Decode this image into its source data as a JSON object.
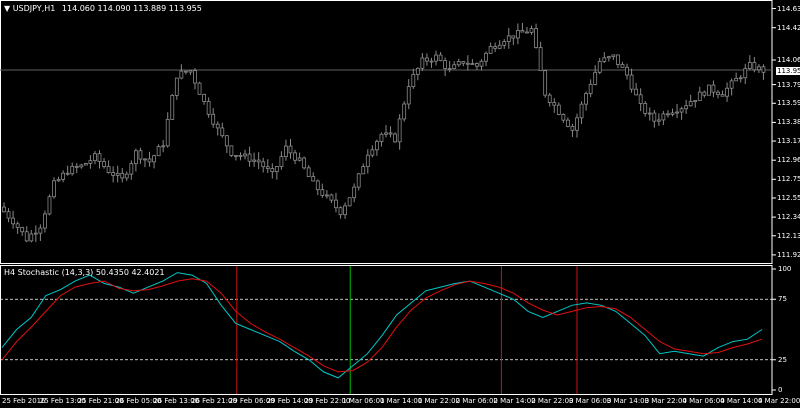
{
  "main_panel": {
    "symbol_label": "USDJPY,H1",
    "ohlc_text": "114.060 114.090 113.889 113.955",
    "current_price": "113.955"
  },
  "indicator_panel": {
    "label": "H4 Stochastic (14,3,3) 50.4350 42.4021"
  },
  "colors": {
    "background": "#000000",
    "grid": "#3a3a3a",
    "candle": "#8a8a8a",
    "main_line": "#00c8c8",
    "signal_line": "#e01010",
    "vline_red": "#d01010",
    "vline_green": "#00c000",
    "level_line": "#ffffff"
  },
  "chart_data": [
    {
      "type": "candlestick",
      "title": "USDJPY,H1",
      "price_axis_ticks": [
        "114.630",
        "114.420",
        "114.065",
        "113.795",
        "113.590",
        "113.380",
        "113.175",
        "112.965",
        "112.755",
        "112.550",
        "112.340",
        "112.135",
        "111.925"
      ],
      "price_range": [
        111.88,
        114.68
      ],
      "time_labels": [
        "25 Feb 2016",
        "25 Feb 13:00",
        "25 Feb 21:00",
        "26 Feb 05:00",
        "26 Feb 13:00",
        "26 Feb 21:00",
        "29 Feb 06:00",
        "29 Feb 14:00",
        "29 Feb 22:00",
        "1 Mar 06:00",
        "1 Mar 14:00",
        "1 Mar 22:00",
        "2 Mar 06:00",
        "2 Mar 14:00",
        "2 Mar 22:00",
        "3 Mar 06:00",
        "3 Mar 14:00",
        "3 Mar 22:00",
        "4 Mar 06:00",
        "4 Mar 14:00",
        "4 Mar 22:00"
      ],
      "close_path": [
        112.45,
        112.3,
        112.1,
        112.25,
        112.7,
        112.85,
        112.9,
        113.0,
        112.85,
        112.75,
        113.05,
        112.95,
        113.15,
        113.9,
        113.95,
        113.6,
        113.3,
        113.05,
        113.0,
        112.95,
        112.8,
        113.1,
        112.95,
        112.7,
        112.55,
        112.4,
        112.65,
        113.05,
        113.25,
        113.2,
        113.8,
        114.05,
        114.1,
        113.95,
        114.05,
        114.0,
        114.2,
        114.3,
        114.35,
        114.4,
        113.7,
        113.5,
        113.3,
        113.7,
        114.05,
        114.1,
        113.9,
        113.55,
        113.4,
        113.5,
        113.55,
        113.65,
        113.75,
        113.7,
        113.85,
        114.0,
        113.95
      ]
    },
    {
      "type": "line",
      "title": "H4 Stochastic (14,3,3)",
      "y_ticks": [
        "100",
        "75",
        "25",
        "0"
      ],
      "ylim": [
        0,
        100
      ],
      "levels": [
        75,
        25
      ],
      "series": [
        {
          "name": "main",
          "values": [
            35,
            50,
            60,
            78,
            83,
            90,
            95,
            88,
            85,
            80,
            85,
            90,
            97,
            95,
            88,
            70,
            55,
            50,
            45,
            40,
            32,
            25,
            15,
            10,
            20,
            30,
            45,
            62,
            72,
            82,
            85,
            88,
            90,
            85,
            80,
            75,
            65,
            60,
            65,
            70,
            72,
            70,
            65,
            55,
            45,
            30,
            32,
            30,
            28,
            35,
            40,
            42,
            50
          ]
        },
        {
          "name": "signal",
          "values": [
            25,
            40,
            52,
            65,
            78,
            85,
            88,
            90,
            84,
            82,
            83,
            86,
            90,
            92,
            90,
            80,
            65,
            55,
            48,
            42,
            35,
            28,
            20,
            15,
            16,
            23,
            35,
            52,
            66,
            76,
            82,
            87,
            90,
            88,
            85,
            80,
            72,
            66,
            62,
            65,
            68,
            69,
            67,
            60,
            50,
            40,
            34,
            32,
            30,
            31,
            35,
            38,
            42
          ]
        }
      ],
      "vertical_markers": [
        {
          "label": "29 Feb 06:00",
          "color": "red"
        },
        {
          "label": "1 Mar 06:00",
          "color": "green"
        },
        {
          "label": "2 Mar 14:00",
          "color": "red"
        },
        {
          "label": "3 Mar 06:00",
          "color": "red"
        }
      ]
    }
  ]
}
